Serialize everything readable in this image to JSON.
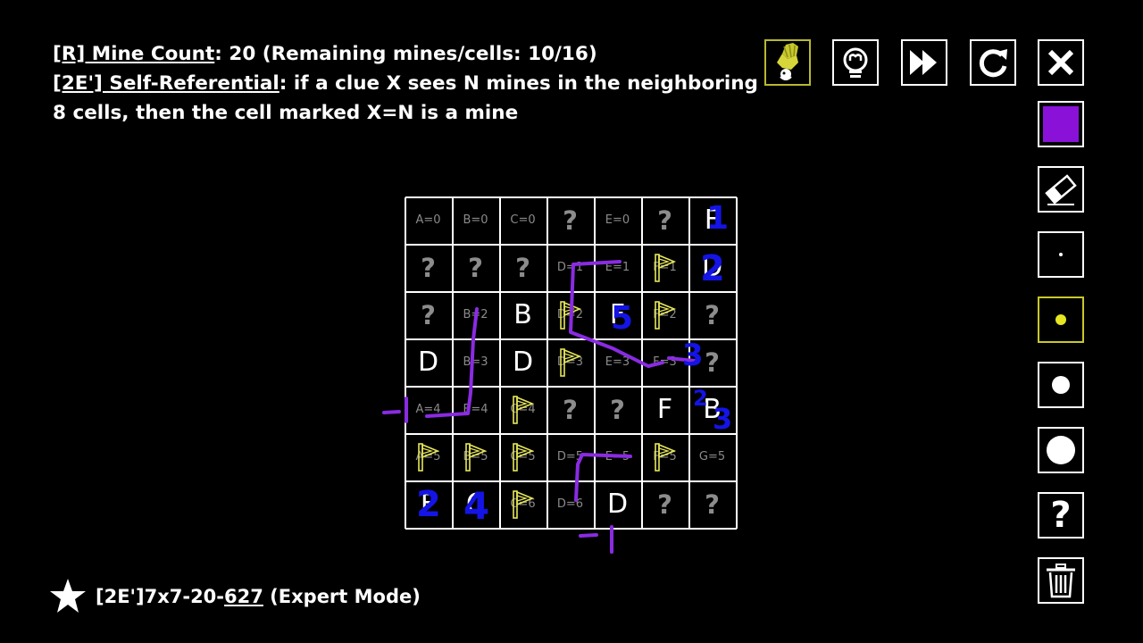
{
  "rules": {
    "mine_count_label": "[R] Mine Count",
    "mine_count_text": ":  20 (Remaining mines/cells: 10/16)",
    "rule_label": "[2E'] Self-Referential",
    "rule_text": ": if a clue X sees N mines in the neighboring 8 cells, then the cell marked X=N is a mine"
  },
  "footer": {
    "puzzle_prefix": "[2E']7x7-20-",
    "puzzle_number": "627",
    "puzzle_suffix": " (Expert Mode)"
  },
  "toolbar": {
    "top": [
      {
        "name": "brush-button",
        "icon": "paintbrush-icon"
      },
      {
        "name": "hint-button",
        "icon": "lightbulb-icon"
      },
      {
        "name": "fast-forward-button",
        "icon": "fast-forward-icon"
      },
      {
        "name": "restart-button",
        "icon": "restart-icon"
      },
      {
        "name": "close-button",
        "icon": "close-icon"
      }
    ],
    "side": [
      {
        "name": "color-swatch-button",
        "icon": "purple-square-icon"
      },
      {
        "name": "eraser-button",
        "icon": "eraser-icon"
      },
      {
        "name": "pen-size-tiny-button",
        "icon": "dot-tiny-icon"
      },
      {
        "name": "pen-size-small-button",
        "icon": "dot-small-icon"
      },
      {
        "name": "pen-size-medium-button",
        "icon": "dot-medium-icon"
      },
      {
        "name": "pen-size-large-button",
        "icon": "dot-large-icon"
      },
      {
        "name": "question-mark-button",
        "icon": "question-icon"
      },
      {
        "name": "trash-button",
        "icon": "trash-icon"
      }
    ]
  },
  "colors": {
    "pen": "#8a2be2",
    "annotation": "#1414e6",
    "flag": "#e6e65a",
    "swatch": "#8a12d8",
    "active_border": "#c8c82a",
    "clue_text": "#8a8a8a"
  },
  "board": {
    "rows": [
      [
        {
          "t": "small",
          "v": "A=0"
        },
        {
          "t": "small",
          "v": "B=0"
        },
        {
          "t": "small",
          "v": "C=0"
        },
        {
          "t": "q",
          "v": "?"
        },
        {
          "t": "small",
          "v": "E=0"
        },
        {
          "t": "q",
          "v": "?"
        },
        {
          "t": "big",
          "v": "F"
        }
      ],
      [
        {
          "t": "q",
          "v": "?"
        },
        {
          "t": "q",
          "v": "?"
        },
        {
          "t": "q",
          "v": "?"
        },
        {
          "t": "small",
          "v": "D=1"
        },
        {
          "t": "small",
          "v": "E=1"
        },
        {
          "t": "flag",
          "v": "F=1"
        },
        {
          "t": "big",
          "v": "D"
        }
      ],
      [
        {
          "t": "q",
          "v": "?"
        },
        {
          "t": "small",
          "v": "B=2"
        },
        {
          "t": "big",
          "v": "B"
        },
        {
          "t": "flag",
          "v": "D=2"
        },
        {
          "t": "big",
          "v": "F"
        },
        {
          "t": "flag",
          "v": "F=2"
        },
        {
          "t": "q",
          "v": "?"
        }
      ],
      [
        {
          "t": "big",
          "v": "D"
        },
        {
          "t": "small",
          "v": "B=3"
        },
        {
          "t": "big",
          "v": "D"
        },
        {
          "t": "flag",
          "v": "D=3"
        },
        {
          "t": "small",
          "v": "E=3"
        },
        {
          "t": "small",
          "v": "F=3"
        },
        {
          "t": "q",
          "v": "?"
        }
      ],
      [
        {
          "t": "small",
          "v": "A=4"
        },
        {
          "t": "small",
          "v": "B=4"
        },
        {
          "t": "flag",
          "v": "C=4"
        },
        {
          "t": "q",
          "v": "?"
        },
        {
          "t": "q",
          "v": "?"
        },
        {
          "t": "big",
          "v": "F"
        },
        {
          "t": "big",
          "v": "B"
        }
      ],
      [
        {
          "t": "flag",
          "v": "A=5"
        },
        {
          "t": "flag",
          "v": "B=5"
        },
        {
          "t": "flag",
          "v": "C=5"
        },
        {
          "t": "small",
          "v": "D=5"
        },
        {
          "t": "small",
          "v": "E=5"
        },
        {
          "t": "flag",
          "v": "F=5"
        },
        {
          "t": "small",
          "v": "G=5"
        }
      ],
      [
        {
          "t": "big",
          "v": "F"
        },
        {
          "t": "big",
          "v": "C"
        },
        {
          "t": "flag",
          "v": "C=6"
        },
        {
          "t": "small",
          "v": "D=6"
        },
        {
          "t": "big",
          "v": "D"
        },
        {
          "t": "q",
          "v": "?"
        },
        {
          "t": "q",
          "v": "?"
        }
      ]
    ]
  },
  "annotations": [
    "1",
    "2",
    "5",
    "3",
    "2",
    "3",
    "2",
    "4",
    "-1",
    "-1"
  ]
}
